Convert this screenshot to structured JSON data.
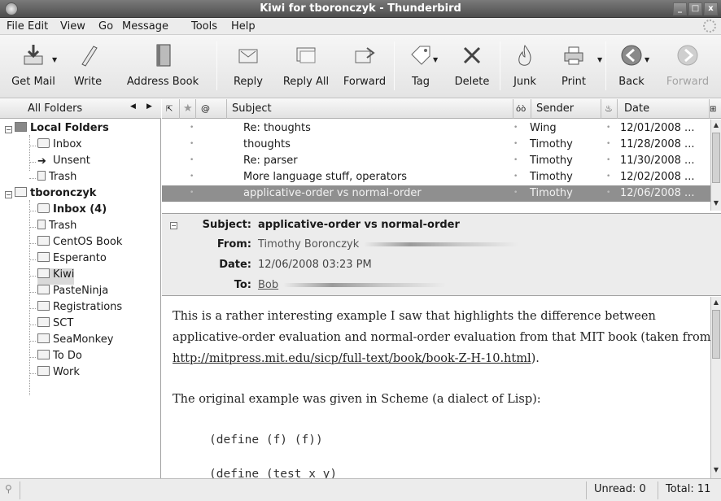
{
  "window": {
    "title": "Kiwi for tboronczyk - Thunderbird"
  },
  "menu": [
    "File",
    "Edit",
    "View",
    "Go",
    "Message",
    "Tools",
    "Help"
  ],
  "toolbar": {
    "get_mail": "Get Mail",
    "write": "Write",
    "address_book": "Address Book",
    "reply": "Reply",
    "reply_all": "Reply All",
    "forward": "Forward",
    "tag": "Tag",
    "delete": "Delete",
    "junk": "Junk",
    "print": "Print",
    "back": "Back",
    "forward_nav": "Forward"
  },
  "folders": {
    "header": "All Folders",
    "local_folders": "Local Folders",
    "inbox": "Inbox",
    "unsent": "Unsent",
    "trash": "Trash",
    "account": "tboronczyk",
    "acc_inbox": "Inbox (4)",
    "acc_trash": "Trash",
    "centos": "CentOS Book",
    "esperanto": "Esperanto",
    "kiwi": "Kiwi",
    "pasteninja": "PasteNinja",
    "registrations": "Registrations",
    "sct": "SCT",
    "seamonkey": "SeaMonkey",
    "todo": "To Do",
    "work": "Work"
  },
  "thread": {
    "col_subject": "Subject",
    "col_sender": "Sender",
    "col_date": "Date",
    "rows": [
      {
        "subject": "Re: thoughts",
        "sender": "Wing",
        "date": "12/01/2008 ..."
      },
      {
        "subject": "thoughts",
        "sender": "Timothy",
        "date": "11/28/2008 ..."
      },
      {
        "subject": "Re: parser",
        "sender": "Timothy",
        "date": "11/30/2008 ..."
      },
      {
        "subject": "More language stuff, operators",
        "sender": "Timothy",
        "date": "12/02/2008 ..."
      },
      {
        "subject": "applicative-order vs normal-order",
        "sender": "Timothy",
        "date": "12/06/2008 ..."
      }
    ]
  },
  "headers": {
    "subject_label": "Subject:",
    "subject": "applicative-order vs normal-order",
    "from_label": "From:",
    "from": "Timothy Boronczyk",
    "date_label": "Date:",
    "date": "12/06/2008 03:23 PM",
    "to_label": "To:",
    "to": "Bob"
  },
  "body": {
    "line1": "This is a rather interesting example I saw that highlights the difference between",
    "line2": "applicative-order evaluation and normal-order evaluation from that MIT book (taken from",
    "link": "http://mitpress.mit.edu/sicp/full-text/book/book-Z-H-10.html",
    "line3_tail": ").",
    "line4": "The original example was given in Scheme (a dialect of Lisp):",
    "code1": "(define (f) (f))",
    "code2": "(define (test x y)"
  },
  "status": {
    "unread": "Unread: 0",
    "total": "Total: 11"
  }
}
